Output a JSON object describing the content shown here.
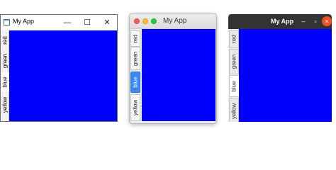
{
  "windows_style": {
    "title": "My App",
    "controls": {
      "minimize": "—",
      "maximize": "☐",
      "close": "✕"
    },
    "tabs": [
      {
        "label": "red",
        "selected": false
      },
      {
        "label": "green",
        "selected": false
      },
      {
        "label": "blue",
        "selected": true
      },
      {
        "label": "yellow",
        "selected": false
      }
    ],
    "content_color": "#0000fe"
  },
  "macos_style": {
    "title": "My App",
    "tabs": [
      {
        "label": "red",
        "selected": false
      },
      {
        "label": "green",
        "selected": false
      },
      {
        "label": "blue",
        "selected": true
      },
      {
        "label": "yellow",
        "selected": false
      }
    ],
    "content_color": "#0000fe",
    "selected_tab_color": "#3b86f0"
  },
  "ubuntu_style": {
    "title": "My App",
    "controls": {
      "minimize": "–",
      "maximize": "▫",
      "close": "×"
    },
    "tabs": [
      {
        "label": "red",
        "selected": false
      },
      {
        "label": "green",
        "selected": false
      },
      {
        "label": "blue",
        "selected": true
      },
      {
        "label": "yellow",
        "selected": false
      }
    ],
    "content_color": "#0000fe",
    "close_button_color": "#e95420"
  }
}
